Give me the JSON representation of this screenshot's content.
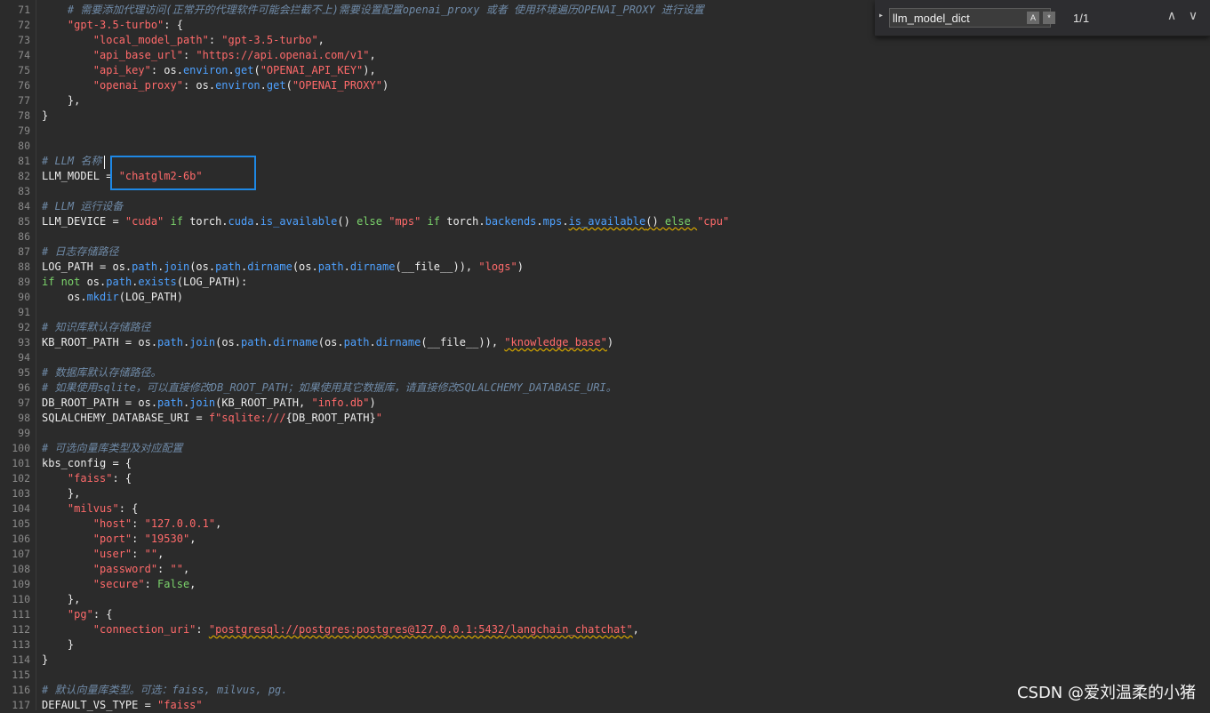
{
  "find": {
    "query": "llm_model_dict",
    "case_icon": "A",
    "regex_icon": "*",
    "count": "1/1",
    "expand_icon": "▸",
    "prev_icon": "∧",
    "next_icon": "∨",
    "close_icon": "✕"
  },
  "watermark": "CSDN @爱刘温柔的小猪",
  "colors": {
    "background": "#2b2b2b",
    "comment": "#6f8aa7",
    "string": "#ff6a6a",
    "keyword": "#7bd36b",
    "attribute": "#4ea1ff",
    "highlight_box": "#1e88e5"
  },
  "code_lines": [
    {
      "n": "71",
      "t": [
        [
          "comment",
          "    # 需要添加代理访问(正常开的代理软件可能会拦截不上)需要设置配置openai_proxy 或者 使用环境遍历OPENAI_PROXY 进行设置"
        ]
      ]
    },
    {
      "n": "72",
      "t": [
        [
          "default",
          "    "
        ],
        [
          "string",
          "\"gpt-3.5-turbo\""
        ],
        [
          "default",
          ": {"
        ]
      ]
    },
    {
      "n": "73",
      "t": [
        [
          "default",
          "        "
        ],
        [
          "string",
          "\"local_model_path\""
        ],
        [
          "default",
          ": "
        ],
        [
          "string",
          "\"gpt-3.5-turbo\""
        ],
        [
          "default",
          ","
        ]
      ]
    },
    {
      "n": "74",
      "t": [
        [
          "default",
          "        "
        ],
        [
          "string",
          "\"api_base_url\""
        ],
        [
          "default",
          ": "
        ],
        [
          "string",
          "\"https://api.openai.com/v1\""
        ],
        [
          "default",
          ","
        ]
      ]
    },
    {
      "n": "75",
      "t": [
        [
          "default",
          "        "
        ],
        [
          "string",
          "\"api_key\""
        ],
        [
          "default",
          ": os."
        ],
        [
          "attr",
          "environ"
        ],
        [
          "default",
          "."
        ],
        [
          "attr",
          "get"
        ],
        [
          "default",
          "("
        ],
        [
          "string",
          "\"OPENAI_API_KEY\""
        ],
        [
          "default",
          "),"
        ]
      ]
    },
    {
      "n": "76",
      "t": [
        [
          "default",
          "        "
        ],
        [
          "string",
          "\"openai_proxy\""
        ],
        [
          "default",
          ": os."
        ],
        [
          "attr",
          "environ"
        ],
        [
          "default",
          "."
        ],
        [
          "attr",
          "get"
        ],
        [
          "default",
          "("
        ],
        [
          "string",
          "\"OPENAI_PROXY\""
        ],
        [
          "default",
          ")"
        ]
      ]
    },
    {
      "n": "77",
      "t": [
        [
          "default",
          "    },"
        ]
      ]
    },
    {
      "n": "78",
      "t": [
        [
          "default",
          "}"
        ]
      ]
    },
    {
      "n": "79",
      "t": []
    },
    {
      "n": "80",
      "t": []
    },
    {
      "n": "81",
      "t": [
        [
          "comment",
          "# LLM 名称"
        ]
      ]
    },
    {
      "n": "82",
      "t": [
        [
          "default",
          "LLM_MODEL = "
        ],
        [
          "string",
          "\"chatglm2-6b\""
        ]
      ]
    },
    {
      "n": "83",
      "t": []
    },
    {
      "n": "84",
      "t": [
        [
          "comment",
          "# LLM 运行设备"
        ]
      ]
    },
    {
      "n": "85",
      "t": [
        [
          "default",
          "LLM_DEVICE = "
        ],
        [
          "string",
          "\"cuda\""
        ],
        [
          "keyword",
          " if "
        ],
        [
          "default",
          "torch."
        ],
        [
          "attr",
          "cuda"
        ],
        [
          "default",
          "."
        ],
        [
          "attr",
          "is_available"
        ],
        [
          "default",
          "() "
        ],
        [
          "keyword",
          "else "
        ],
        [
          "string",
          "\"mps\""
        ],
        [
          "keyword",
          " if "
        ],
        [
          "default",
          "torch."
        ],
        [
          "attr",
          "backends"
        ],
        [
          "default",
          "."
        ],
        [
          "attr",
          "mps"
        ],
        [
          "default",
          "."
        ],
        [
          "attr",
          "is_available"
        ],
        [
          "default",
          "()"
        ],
        [
          "keyword",
          " else "
        ],
        [
          "string",
          "\"cpu\""
        ]
      ]
    },
    {
      "n": "86",
      "t": []
    },
    {
      "n": "87",
      "t": [
        [
          "comment",
          "# 日志存储路径"
        ]
      ]
    },
    {
      "n": "88",
      "t": [
        [
          "default",
          "LOG_PATH = os."
        ],
        [
          "attr",
          "path"
        ],
        [
          "default",
          "."
        ],
        [
          "attr",
          "join"
        ],
        [
          "default",
          "(os."
        ],
        [
          "attr",
          "path"
        ],
        [
          "default",
          "."
        ],
        [
          "attr",
          "dirname"
        ],
        [
          "default",
          "(os."
        ],
        [
          "attr",
          "path"
        ],
        [
          "default",
          "."
        ],
        [
          "attr",
          "dirname"
        ],
        [
          "default",
          "(__file__)), "
        ],
        [
          "string",
          "\"logs\""
        ],
        [
          "default",
          ")"
        ]
      ]
    },
    {
      "n": "89",
      "t": [
        [
          "keyword",
          "if not "
        ],
        [
          "default",
          "os."
        ],
        [
          "attr",
          "path"
        ],
        [
          "default",
          "."
        ],
        [
          "attr",
          "exists"
        ],
        [
          "default",
          "(LOG_PATH):"
        ]
      ]
    },
    {
      "n": "90",
      "t": [
        [
          "default",
          "    os."
        ],
        [
          "attr",
          "mkdir"
        ],
        [
          "default",
          "(LOG_PATH)"
        ]
      ]
    },
    {
      "n": "91",
      "t": []
    },
    {
      "n": "92",
      "t": [
        [
          "comment",
          "# 知识库默认存储路径"
        ]
      ]
    },
    {
      "n": "93",
      "t": [
        [
          "default",
          "KB_ROOT_PATH = os."
        ],
        [
          "attr",
          "path"
        ],
        [
          "default",
          "."
        ],
        [
          "attr",
          "join"
        ],
        [
          "default",
          "(os."
        ],
        [
          "attr",
          "path"
        ],
        [
          "default",
          "."
        ],
        [
          "attr",
          "dirname"
        ],
        [
          "default",
          "(os."
        ],
        [
          "attr",
          "path"
        ],
        [
          "default",
          "."
        ],
        [
          "attr",
          "dirname"
        ],
        [
          "default",
          "(__file__)), "
        ],
        [
          "string",
          "\"knowledge_base\""
        ],
        [
          "default",
          ")"
        ]
      ]
    },
    {
      "n": "94",
      "t": []
    },
    {
      "n": "95",
      "t": [
        [
          "comment",
          "# 数据库默认存储路径。"
        ]
      ]
    },
    {
      "n": "96",
      "t": [
        [
          "comment",
          "# 如果使用sqlite，可以直接修改DB_ROOT_PATH；如果使用其它数据库，请直接修改SQLALCHEMY_DATABASE_URI。"
        ]
      ]
    },
    {
      "n": "97",
      "t": [
        [
          "default",
          "DB_ROOT_PATH = os."
        ],
        [
          "attr",
          "path"
        ],
        [
          "default",
          "."
        ],
        [
          "attr",
          "join"
        ],
        [
          "default",
          "(KB_ROOT_PATH, "
        ],
        [
          "string",
          "\"info.db\""
        ],
        [
          "default",
          ")"
        ]
      ]
    },
    {
      "n": "98",
      "t": [
        [
          "default",
          "SQLALCHEMY_DATABASE_URI = "
        ],
        [
          "string",
          "f\"sqlite:///"
        ],
        [
          "default",
          "{DB_ROOT_PATH}"
        ],
        [
          "string",
          "\""
        ]
      ]
    },
    {
      "n": "99",
      "t": []
    },
    {
      "n": "100",
      "t": [
        [
          "comment",
          "# 可选向量库类型及对应配置"
        ]
      ]
    },
    {
      "n": "101",
      "t": [
        [
          "default",
          "kbs_config = {"
        ]
      ]
    },
    {
      "n": "102",
      "t": [
        [
          "default",
          "    "
        ],
        [
          "string",
          "\"faiss\""
        ],
        [
          "default",
          ": {"
        ]
      ]
    },
    {
      "n": "103",
      "t": [
        [
          "default",
          "    },"
        ]
      ]
    },
    {
      "n": "104",
      "t": [
        [
          "default",
          "    "
        ],
        [
          "string",
          "\"milvus\""
        ],
        [
          "default",
          ": {"
        ]
      ]
    },
    {
      "n": "105",
      "t": [
        [
          "default",
          "        "
        ],
        [
          "string",
          "\"host\""
        ],
        [
          "default",
          ": "
        ],
        [
          "string",
          "\"127.0.0.1\""
        ],
        [
          "default",
          ","
        ]
      ]
    },
    {
      "n": "106",
      "t": [
        [
          "default",
          "        "
        ],
        [
          "string",
          "\"port\""
        ],
        [
          "default",
          ": "
        ],
        [
          "string",
          "\"19530\""
        ],
        [
          "default",
          ","
        ]
      ]
    },
    {
      "n": "107",
      "t": [
        [
          "default",
          "        "
        ],
        [
          "string",
          "\"user\""
        ],
        [
          "default",
          ": "
        ],
        [
          "string",
          "\"\""
        ],
        [
          "default",
          ","
        ]
      ]
    },
    {
      "n": "108",
      "t": [
        [
          "default",
          "        "
        ],
        [
          "string",
          "\"password\""
        ],
        [
          "default",
          ": "
        ],
        [
          "string",
          "\"\""
        ],
        [
          "default",
          ","
        ]
      ]
    },
    {
      "n": "109",
      "t": [
        [
          "default",
          "        "
        ],
        [
          "string",
          "\"secure\""
        ],
        [
          "default",
          ": "
        ],
        [
          "keyword",
          "False"
        ],
        [
          "default",
          ","
        ]
      ]
    },
    {
      "n": "110",
      "t": [
        [
          "default",
          "    },"
        ]
      ]
    },
    {
      "n": "111",
      "t": [
        [
          "default",
          "    "
        ],
        [
          "string",
          "\"pg\""
        ],
        [
          "default",
          ": {"
        ]
      ]
    },
    {
      "n": "112",
      "t": [
        [
          "default",
          "        "
        ],
        [
          "string",
          "\"connection_uri\""
        ],
        [
          "default",
          ": "
        ],
        [
          "string",
          "\"postgresql://postgres:postgres@127.0.0.1:5432/langchain_chatchat\""
        ],
        [
          "default",
          ","
        ]
      ]
    },
    {
      "n": "113",
      "t": [
        [
          "default",
          "    }"
        ]
      ]
    },
    {
      "n": "114",
      "t": [
        [
          "default",
          "}"
        ]
      ]
    },
    {
      "n": "115",
      "t": []
    },
    {
      "n": "116",
      "t": [
        [
          "comment",
          "# 默认向量库类型。可选：faiss, milvus, pg."
        ]
      ]
    },
    {
      "n": "117",
      "t": [
        [
          "default",
          "DEFAULT_VS_TYPE = "
        ],
        [
          "string",
          "\"faiss\""
        ]
      ]
    }
  ]
}
